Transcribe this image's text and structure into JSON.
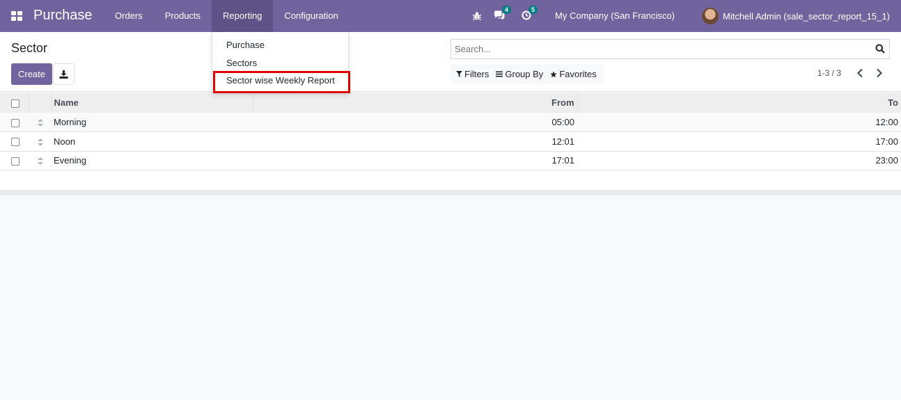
{
  "navbar": {
    "brand": "Purchase",
    "menu": [
      {
        "label": "Orders"
      },
      {
        "label": "Products"
      },
      {
        "label": "Reporting",
        "active": true
      },
      {
        "label": "Configuration"
      }
    ],
    "messages_count": "4",
    "activities_count": "5",
    "company": "My Company (San Francisco)",
    "user": "Mitchell Admin (sale_sector_report_15_1)"
  },
  "reporting_menu": {
    "items": [
      "Purchase",
      "Sectors",
      "Sector wise Weekly Report"
    ],
    "highlighted": "Sector wise Weekly Report"
  },
  "control_panel": {
    "title": "Sector",
    "create_label": "Create",
    "search_placeholder": "Search...",
    "filters_label": "Filters",
    "group_by_label": "Group By",
    "favorites_label": "Favorites",
    "pager": "1-3 / 3"
  },
  "table": {
    "columns": [
      "Name",
      "From",
      "To"
    ],
    "rows": [
      {
        "name": "Morning",
        "from": "05:00",
        "to": "12:00"
      },
      {
        "name": "Noon",
        "from": "12:01",
        "to": "17:00"
      },
      {
        "name": "Evening",
        "from": "17:01",
        "to": "23:00"
      }
    ]
  },
  "colors": {
    "navbar": "#71639e",
    "primary_button": "#71639e",
    "badge": "#017e84",
    "highlight_box": "#e00000"
  }
}
